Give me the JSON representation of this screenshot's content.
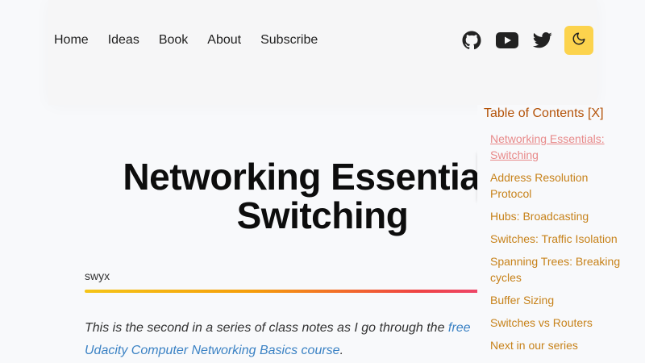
{
  "nav": {
    "items": [
      "Home",
      "Ideas",
      "Book",
      "About",
      "Subscribe"
    ]
  },
  "social": {
    "icons": [
      "github-icon",
      "youtube-icon",
      "twitter-icon"
    ],
    "theme_icon": "moon-icon",
    "accent": "#fcd34d"
  },
  "article": {
    "title_line1": "Networking Essentials:",
    "title_line2": "Switching",
    "author": "swyx",
    "intro_text": "This is the second in a series of class notes as I go through the ",
    "intro_link": "free Udacity Computer Networking Basics course",
    "intro_end": "."
  },
  "toc": {
    "title": "Table of Contents [X]",
    "items": [
      "Networking Essentials: Switching",
      "Address Resolution Protocol",
      "Hubs: Broadcasting",
      "Switches: Traffic Isolation",
      "Spanning Trees: Breaking cycles",
      "Buffer Sizing",
      "Switches vs Routers",
      "Next in our series"
    ]
  },
  "colors": {
    "toc_link": "#c7821a",
    "toc_active": "#e88a8a",
    "toc_title": "#b45309",
    "body_link": "#3b82c4"
  }
}
